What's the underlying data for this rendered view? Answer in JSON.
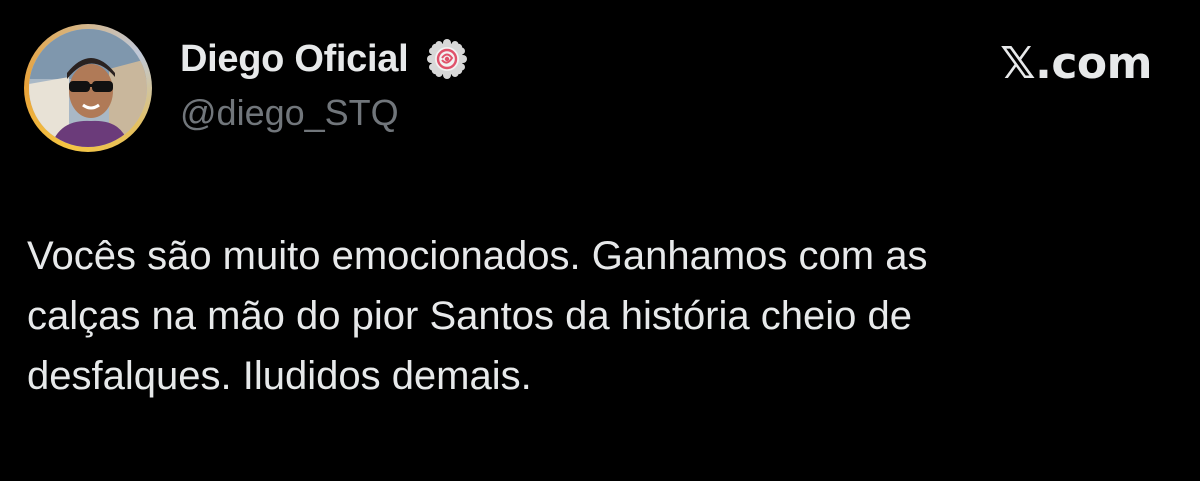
{
  "author": {
    "display_name": "Diego Oficial",
    "handle": "@diego_STQ",
    "avatar": "profile-photo",
    "badge": "verified-seal-icon"
  },
  "brand": {
    "label": "𝕏.com"
  },
  "tweet": {
    "lines": [
      "Vocês são muito emocionados. Ganhamos com as",
      "calças na mão do pior Santos da história cheio de",
      "desfalques. Iludidos demais."
    ]
  },
  "colors": {
    "background": "#000000",
    "text_primary": "#e7e9ea",
    "text_secondary": "#71767b",
    "avatar_ring": "#e8a23a"
  }
}
